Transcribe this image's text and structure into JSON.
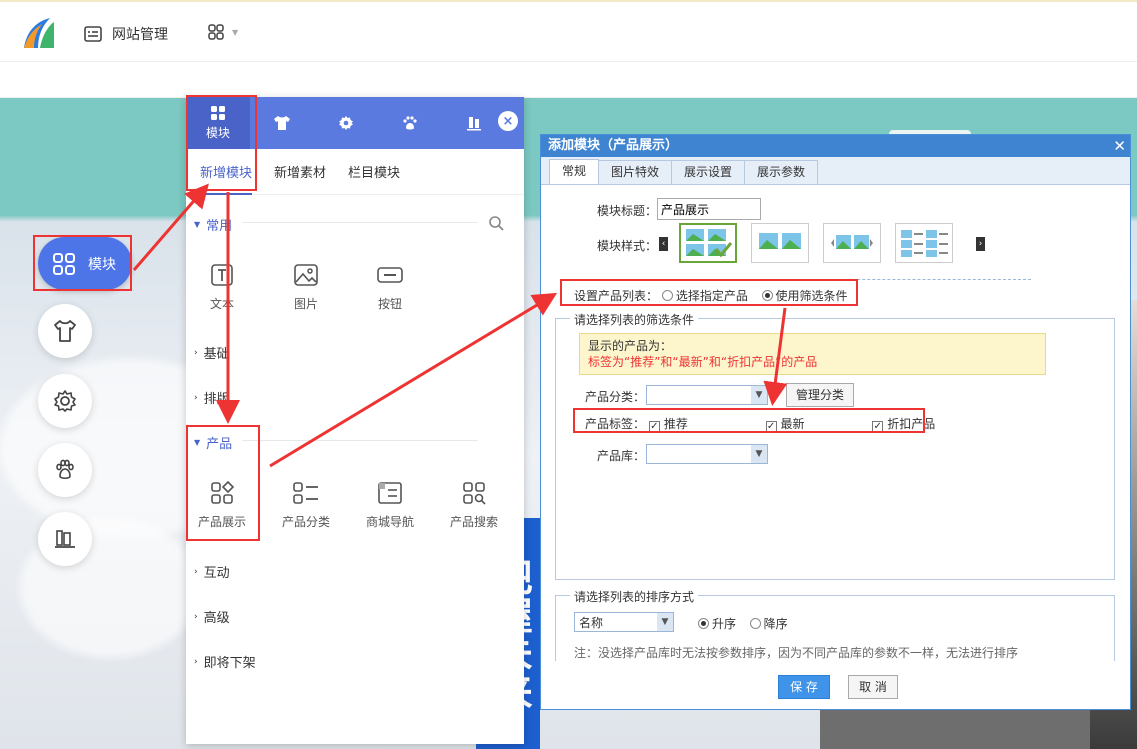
{
  "topbar": {
    "site_manage": "网站管理"
  },
  "dock": {
    "main_label": "模块"
  },
  "panel": {
    "tabs": [
      "模块"
    ],
    "subtabs": [
      "新增模块",
      "新增素材",
      "栏目模块"
    ],
    "sections": {
      "common": "常用",
      "basic": "基础",
      "layout": "排版",
      "product": "产品",
      "interact": "互动",
      "advanced": "高级",
      "soon": "即将下架"
    },
    "common_items": [
      "文本",
      "图片",
      "按钮"
    ],
    "product_items": [
      "产品展示",
      "产品分类",
      "商城导航",
      "产品搜索"
    ]
  },
  "canvas": {
    "banner_text": "把握未来"
  },
  "dialog": {
    "title": "添加模块（产品展示）",
    "tabs": [
      "常规",
      "图片特效",
      "展示设置",
      "展示参数"
    ],
    "module_title_label": "模块标题：",
    "module_title_value": "产品展示",
    "module_style_label": "模块样式：",
    "list_label": "设置产品列表：",
    "radio_specify": "选择指定产品",
    "radio_filter": "使用筛选条件",
    "filter_legend": "请选择列表的筛选条件",
    "notice_line1": "显示的产品为：",
    "notice_line2": "标签为“推荐”和“最新”和“折扣产品”的产品",
    "category_label": "产品分类：",
    "manage_category": "管理分类",
    "tag_label": "产品标签：",
    "tags": [
      "推荐",
      "最新",
      "折扣产品"
    ],
    "library_label": "产品库：",
    "sort_legend": "请选择列表的排序方式",
    "sort_field": "名称",
    "asc": "升序",
    "desc": "降序",
    "sort_note": "注：没选择产品库时无法按参数排序，因为不同产品库的参数不一样，无法进行排序",
    "save": "保 存",
    "cancel": "取 消"
  },
  "colors": {
    "accent": "#4a63c9",
    "annotation": "#e33333",
    "dialog_title": "#3f84d1"
  }
}
